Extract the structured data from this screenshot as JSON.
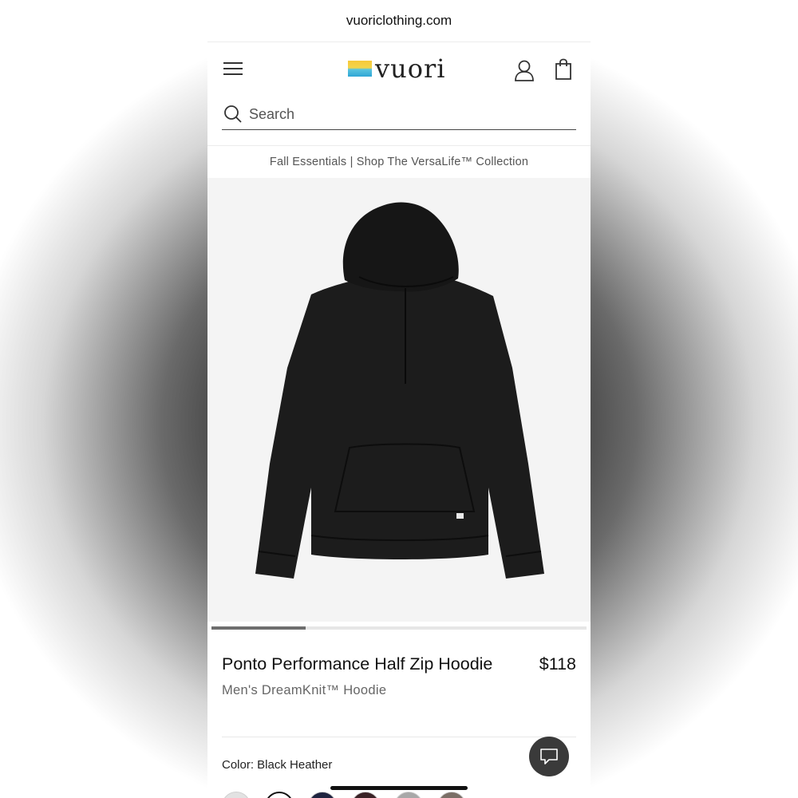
{
  "browser": {
    "url": "vuoriclothing.com"
  },
  "header": {
    "logo_text": "vuori"
  },
  "search": {
    "placeholder": "Search"
  },
  "promo": {
    "text": "Fall Essentials | Shop The VersaLife™ Collection"
  },
  "gallery": {
    "progress": 0.25
  },
  "product": {
    "name": "Ponto Performance Half Zip Hoodie",
    "price": "$118",
    "subtitle": "Men's DreamKnit™ Hoodie",
    "color_label": "Color: Black Heather"
  },
  "swatches": [
    {
      "color": "#e2e2e2"
    },
    {
      "color": "#ffffff",
      "selected": true
    },
    {
      "color": "#1f2440"
    },
    {
      "color": "#3a2226"
    },
    {
      "color": "#a8a8a8"
    },
    {
      "color": "#7a6e66"
    }
  ],
  "icons": {
    "menu": "hamburger-menu-icon",
    "account": "user-account-icon",
    "bag": "shopping-bag-icon",
    "search": "search-icon",
    "chat": "chat-icon"
  }
}
